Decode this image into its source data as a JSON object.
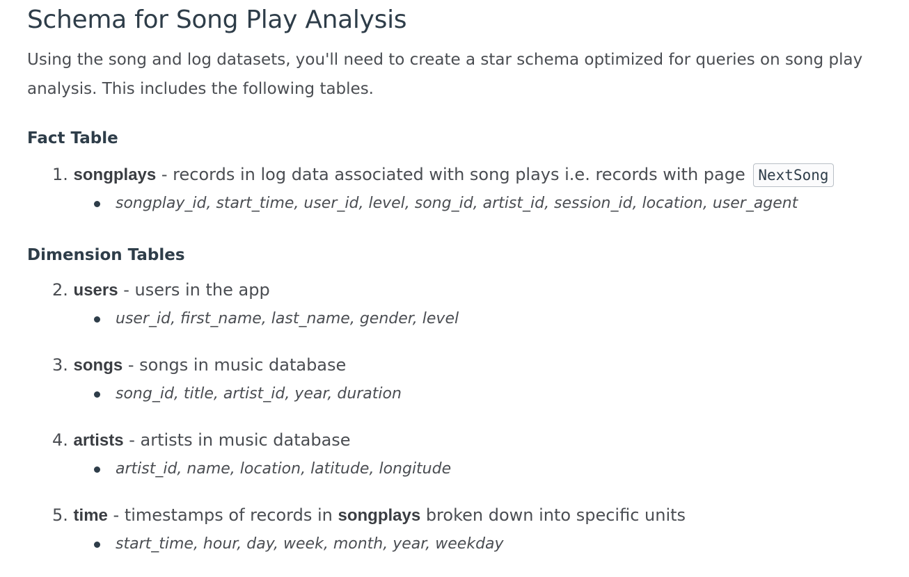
{
  "title": "Schema for Song Play Analysis",
  "intro": "Using the song and log datasets, you'll need to create a star schema optimized for queries on song play analysis. This includes the following tables.",
  "fact_heading": "Fact Table",
  "dimension_heading": "Dimension Tables",
  "items": [
    {
      "number": "1.",
      "name": "songplays",
      "description": " - records in log data associated with song plays i.e. records with page ",
      "code": "NextSong",
      "columns": "songplay_id, start_time, user_id, level, song_id, artist_id, session_id, location, user_agent"
    },
    {
      "number": "2.",
      "name": "users",
      "description": " - users in the app",
      "columns": "user_id, first_name, last_name, gender, level"
    },
    {
      "number": "3.",
      "name": "songs",
      "description": " - songs in music database",
      "columns": "song_id, title, artist_id, year, duration"
    },
    {
      "number": "4.",
      "name": "artists",
      "description": " - artists in music database",
      "columns": "artist_id, name, location, latitude, longitude"
    },
    {
      "number": "5.",
      "name": "time",
      "description": " - timestamps of records in ",
      "ref": "songplays",
      "description_tail": " broken down into specific units",
      "columns": "start_time, hour, day, week, month, year, weekday"
    }
  ]
}
